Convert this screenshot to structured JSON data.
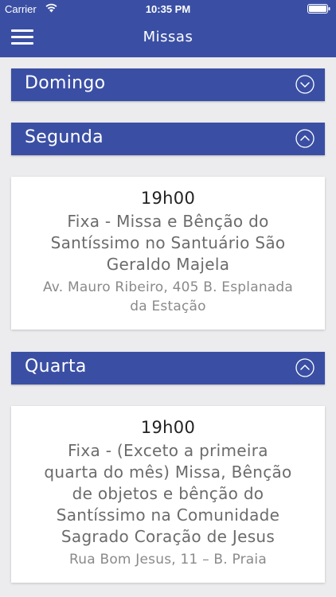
{
  "status_bar": {
    "carrier": "Carrier",
    "time": "10:35 PM"
  },
  "nav": {
    "title": "Missas",
    "menu_icon": "hamburger-menu-icon"
  },
  "days": [
    {
      "label": "Domingo",
      "expanded": false
    },
    {
      "label": "Segunda",
      "expanded": true
    },
    {
      "label": "Quarta",
      "expanded": true
    }
  ],
  "masses": [
    {
      "time": "19h00",
      "desc_lines": [
        "Fixa - Missa e Bênção do",
        "Santíssimo no Santuário São",
        "Geraldo Majela"
      ],
      "addr_lines": [
        "Av. Mauro Ribeiro, 405 B. Esplanada",
        "da Estação"
      ]
    },
    {
      "time": "19h00",
      "desc_lines": [
        "Fixa - (Exceto a primeira",
        "quarta do mês) Missa, Bênção",
        "de objetos e bênção do",
        "Santíssimo na Comunidade",
        "Sagrado Coração de Jesus"
      ],
      "addr_lines": [
        "Rua Bom Jesus, 11 – B. Praia"
      ]
    }
  ],
  "colors": {
    "primary": "#3a4fa4",
    "background": "#ececef",
    "card": "#ffffff"
  }
}
